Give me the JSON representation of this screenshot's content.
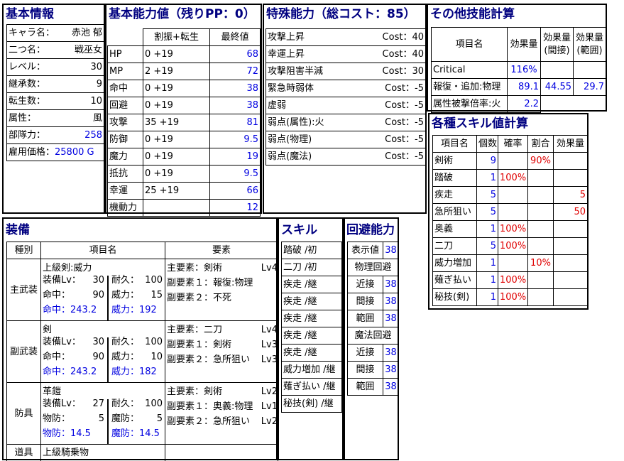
{
  "basic": {
    "title": "基本情報",
    "rows": [
      {
        "label": "キャラ名：",
        "value": "赤池 郁",
        "blue": false,
        "align": "c"
      },
      {
        "label": "二つ名：",
        "value": "戦巫女",
        "blue": false
      },
      {
        "label": "レベル：",
        "value": "30",
        "blue": false
      },
      {
        "label": "継承数：",
        "value": "9",
        "blue": false
      },
      {
        "label": "転生数：",
        "value": "10",
        "blue": false
      },
      {
        "label": "属性：",
        "value": "風",
        "blue": false
      },
      {
        "label": "部隊力：",
        "value": "258",
        "blue": true
      },
      {
        "label": "雇用価格：",
        "value": "25800 G",
        "blue": true,
        "single": true
      }
    ]
  },
  "ability": {
    "title": "基本能力値（残りPP：0）",
    "headers": [
      "割振+転生",
      "最終値"
    ],
    "rows": [
      {
        "name": "HP",
        "alloc": "0 +19",
        "final": "68"
      },
      {
        "name": "MP",
        "alloc": "2 +19",
        "final": "72"
      },
      {
        "name": "命中",
        "alloc": "0 +19",
        "final": "38"
      },
      {
        "name": "回避",
        "alloc": "0 +19",
        "final": "38"
      },
      {
        "name": "攻撃",
        "alloc": "35 +19",
        "final": "81"
      },
      {
        "name": "防御",
        "alloc": "0 +19",
        "final": "9.5"
      },
      {
        "name": "魔力",
        "alloc": "0 +19",
        "final": "19"
      },
      {
        "name": "抵抗",
        "alloc": "0 +19",
        "final": "9.5"
      },
      {
        "name": "幸運",
        "alloc": "25 +19",
        "final": "66"
      },
      {
        "name": "機動力",
        "alloc": "",
        "final": "12"
      }
    ]
  },
  "special": {
    "title": "特殊能力（総コスト：85）",
    "rows": [
      {
        "name": "攻撃上昇",
        "cost": "Cost：40"
      },
      {
        "name": "幸運上昇",
        "cost": "Cost：40"
      },
      {
        "name": "攻撃阻害半減",
        "cost": "Cost：30"
      },
      {
        "name": "緊急時弱体",
        "cost": "Cost：-5"
      },
      {
        "name": "虚弱",
        "cost": "Cost：-5"
      },
      {
        "name": "弱点(属性):火",
        "cost": "Cost：-5"
      },
      {
        "name": "弱点(物理)",
        "cost": "Cost：-5"
      },
      {
        "name": "弱点(魔法)",
        "cost": "Cost：-5"
      }
    ]
  },
  "other": {
    "title": "その他技能計算",
    "headers": [
      "項目名",
      "効果量",
      "効果量\n(間接)",
      "効果量\n(範囲)"
    ],
    "h_item": "項目名",
    "h_eff": "効果量",
    "h_ind1": "効果量",
    "h_ind2": "(間接)",
    "h_rng1": "効果量",
    "h_rng2": "(範囲)",
    "critical_label": "Critical",
    "critical_value": "116%",
    "recover_label": "報復・追加:物理",
    "recover_values": [
      "89.1",
      "44.55",
      "29.7"
    ],
    "weak_label": "属性被撃倍率:火",
    "weak_value": "2.2"
  },
  "skillcalc": {
    "title": "各種スキル値計算",
    "headers": [
      "項目名",
      "個数",
      "確率",
      "割合",
      "効果量"
    ],
    "rows": [
      {
        "name": "剣術",
        "count": "9",
        "rate": "",
        "ratio": "90%",
        "effect": ""
      },
      {
        "name": "踏破",
        "count": "1",
        "rate": "100%",
        "ratio": "",
        "effect": ""
      },
      {
        "name": "疾走",
        "count": "5",
        "rate": "",
        "ratio": "",
        "effect": "5"
      },
      {
        "name": "急所狙い",
        "count": "5",
        "rate": "",
        "ratio": "",
        "effect": "50"
      },
      {
        "name": "奥義",
        "count": "1",
        "rate": "100%",
        "ratio": "",
        "effect": ""
      },
      {
        "name": "二刀",
        "count": "5",
        "rate": "100%",
        "ratio": "",
        "effect": ""
      },
      {
        "name": "威力増加",
        "count": "1",
        "rate": "",
        "ratio": "10%",
        "effect": ""
      },
      {
        "name": "薙ぎ払い",
        "count": "1",
        "rate": "100%",
        "ratio": "",
        "effect": ""
      },
      {
        "name": "秘技(剣)",
        "count": "1",
        "rate": "100%",
        "ratio": "",
        "effect": ""
      }
    ]
  },
  "equip": {
    "title": "装備",
    "headers": [
      "種別",
      "項目名",
      "要素"
    ],
    "main": {
      "kind": "主武装",
      "name": "上級剣:威力",
      "l1": "装備Lv：",
      "v1": "30",
      "r1": "耐久：",
      "rv1": "100",
      "l2": "命中：",
      "v2": "90",
      "r2": "威力：",
      "rv2": "15",
      "l3": "命中：243.2",
      "r3": "威力：192",
      "e1": "主要素：剣術",
      "e1lv": "Lv4",
      "e2": "副要素１：報復:物理",
      "e2lv": "",
      "e3": "副要素２：不死",
      "e3lv": ""
    },
    "sub": {
      "kind": "副武装",
      "name": "剣",
      "l1": "装備Lv：",
      "v1": "30",
      "r1": "耐久：",
      "rv1": "100",
      "l2": "命中：",
      "v2": "90",
      "r2": "威力：",
      "rv2": "10",
      "l3": "命中：243.2",
      "r3": "威力：182",
      "e1": "主要素：二刀",
      "e1lv": "Lv4",
      "e2": "副要素１：剣術",
      "e2lv": "Lv3",
      "e3": "副要素２：急所狙い",
      "e3lv": "Lv3"
    },
    "armor": {
      "kind": "防具",
      "name": "革鎧",
      "l1": "装備Lv：",
      "v1": "27",
      "r1": "耐久：",
      "rv1": "100",
      "l2": "物防：",
      "v2": "5",
      "r2": "魔防：",
      "rv2": "5",
      "l3": "物防：14.5",
      "r3": "魔防：14.5",
      "e1": "主要素：剣術",
      "e1lv": "Lv2",
      "e2": "副要素１：奥義:物理",
      "e2lv": "Lv1",
      "e3": "副要素２：急所狙い",
      "e3lv": "Lv2"
    },
    "tool": {
      "kind": "道具",
      "name": "上級騎乗物"
    }
  },
  "skills": {
    "title": "スキル",
    "items": [
      "踏破 /初",
      "二刀 /初",
      "疾走 /継",
      "疾走 /継",
      "疾走 /継",
      "疾走 /継",
      "疾走 /継",
      "威力増加 /継",
      "薙ぎ払い /継",
      "秘技(剣) /継"
    ]
  },
  "evasion": {
    "title": "回避能力",
    "display_label": "表示値",
    "display_value": "38",
    "phys_label": "物理回避",
    "phys": [
      {
        "label": "近接",
        "value": "38"
      },
      {
        "label": "間接",
        "value": "38"
      },
      {
        "label": "範囲",
        "value": "38"
      }
    ],
    "magic_label": "魔法回避",
    "magic": [
      {
        "label": "近接",
        "value": "38"
      },
      {
        "label": "間接",
        "value": "38"
      },
      {
        "label": "範囲",
        "value": "38"
      }
    ]
  }
}
